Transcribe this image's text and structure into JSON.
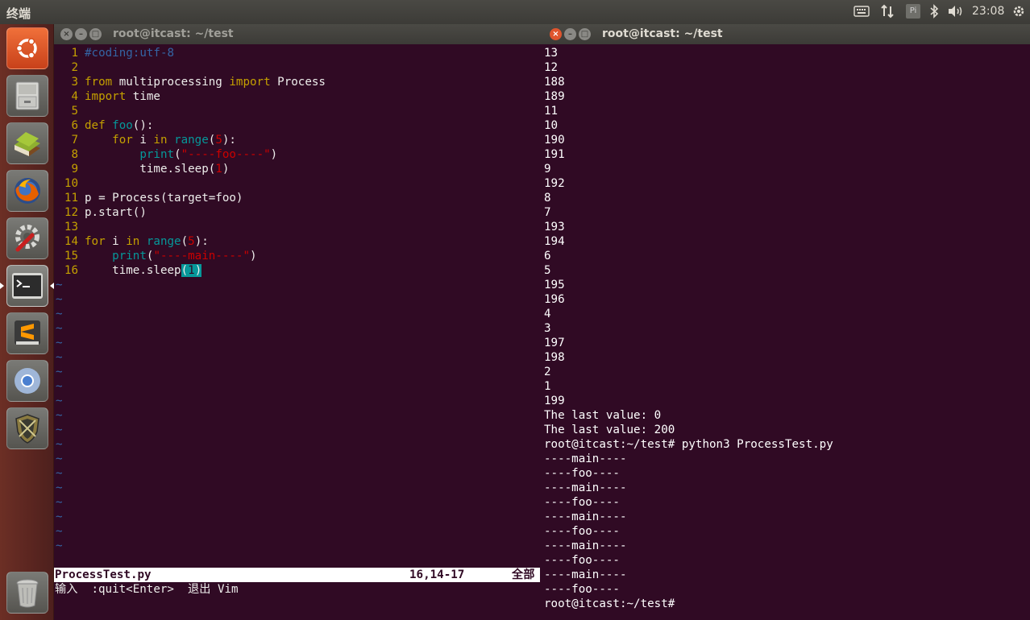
{
  "top_panel": {
    "title": "终端",
    "tray": {
      "keyboard_icon": "keyboard-icon",
      "network_icon": "network-updown-icon",
      "pinyin_label": "Pi",
      "bluetooth_icon": "bluetooth-icon",
      "volume_icon": "volume-icon",
      "clock": "23:08",
      "power_icon": "gear-icon"
    }
  },
  "launcher": {
    "items": [
      {
        "name": "ubuntu-dash",
        "icon": "ubuntu-logo-icon",
        "color": "#e95420"
      },
      {
        "name": "files",
        "icon": "file-cabinet-icon",
        "color": "#bcbcb6"
      },
      {
        "name": "reader",
        "icon": "books-icon",
        "color": "#7a9a2a"
      },
      {
        "name": "firefox",
        "icon": "firefox-icon",
        "color": "#e66000"
      },
      {
        "name": "system-settings",
        "icon": "settings-wrench-icon",
        "color": "#d0d0d0"
      },
      {
        "name": "terminal",
        "icon": "terminal-icon",
        "color": "#2e2e2e"
      },
      {
        "name": "sublime-text",
        "icon": "sublime-icon",
        "color": "#ff9800"
      },
      {
        "name": "chromium",
        "icon": "chromium-icon",
        "color": "#4a90e2"
      },
      {
        "name": "security-app",
        "icon": "shield-icon",
        "color": "#8a7a40"
      },
      {
        "name": "trash",
        "icon": "trash-icon",
        "color": "#b0b0b0"
      }
    ]
  },
  "vim_window": {
    "title": "root@itcast: ~/test",
    "lines": [
      {
        "n": "1",
        "tokens": [
          {
            "t": "#coding:utf-8",
            "c": "c-comment"
          }
        ]
      },
      {
        "n": "2",
        "tokens": []
      },
      {
        "n": "3",
        "tokens": [
          {
            "t": "from",
            "c": "c-kw"
          },
          {
            "t": " multiprocessing ",
            "c": "c-plain"
          },
          {
            "t": "import",
            "c": "c-kw"
          },
          {
            "t": " Process",
            "c": "c-plain"
          }
        ]
      },
      {
        "n": "4",
        "tokens": [
          {
            "t": "import",
            "c": "c-kw"
          },
          {
            "t": " time",
            "c": "c-plain"
          }
        ]
      },
      {
        "n": "5",
        "tokens": []
      },
      {
        "n": "6",
        "tokens": [
          {
            "t": "def",
            "c": "c-kw"
          },
          {
            "t": " ",
            "c": "c-plain"
          },
          {
            "t": "foo",
            "c": "c-fn"
          },
          {
            "t": "():",
            "c": "c-plain"
          }
        ]
      },
      {
        "n": "7",
        "tokens": [
          {
            "t": "    ",
            "c": "c-plain"
          },
          {
            "t": "for",
            "c": "c-kw"
          },
          {
            "t": " i ",
            "c": "c-plain"
          },
          {
            "t": "in",
            "c": "c-kw"
          },
          {
            "t": " ",
            "c": "c-plain"
          },
          {
            "t": "range",
            "c": "c-builtin"
          },
          {
            "t": "(",
            "c": "c-plain"
          },
          {
            "t": "5",
            "c": "c-num"
          },
          {
            "t": "):",
            "c": "c-plain"
          }
        ]
      },
      {
        "n": "8",
        "tokens": [
          {
            "t": "        ",
            "c": "c-plain"
          },
          {
            "t": "print",
            "c": "c-builtin"
          },
          {
            "t": "(",
            "c": "c-plain"
          },
          {
            "t": "\"----foo----\"",
            "c": "c-str"
          },
          {
            "t": ")",
            "c": "c-plain"
          }
        ]
      },
      {
        "n": "9",
        "tokens": [
          {
            "t": "        time.sleep(",
            "c": "c-plain"
          },
          {
            "t": "1",
            "c": "c-num"
          },
          {
            "t": ")",
            "c": "c-plain"
          }
        ]
      },
      {
        "n": "10",
        "tokens": []
      },
      {
        "n": "11",
        "tokens": [
          {
            "t": "p = Process(target=foo)",
            "c": "c-plain"
          }
        ]
      },
      {
        "n": "12",
        "tokens": [
          {
            "t": "p.start()",
            "c": "c-plain"
          }
        ]
      },
      {
        "n": "13",
        "tokens": []
      },
      {
        "n": "14",
        "tokens": [
          {
            "t": "for",
            "c": "c-kw"
          },
          {
            "t": " i ",
            "c": "c-plain"
          },
          {
            "t": "in",
            "c": "c-kw"
          },
          {
            "t": " ",
            "c": "c-plain"
          },
          {
            "t": "range",
            "c": "c-builtin"
          },
          {
            "t": "(",
            "c": "c-plain"
          },
          {
            "t": "5",
            "c": "c-num"
          },
          {
            "t": "):",
            "c": "c-plain"
          }
        ]
      },
      {
        "n": "15",
        "tokens": [
          {
            "t": "    ",
            "c": "c-plain"
          },
          {
            "t": "print",
            "c": "c-builtin"
          },
          {
            "t": "(",
            "c": "c-plain"
          },
          {
            "t": "\"----main----\"",
            "c": "c-str"
          },
          {
            "t": ")",
            "c": "c-plain"
          }
        ]
      },
      {
        "n": "16",
        "tokens": [
          {
            "t": "    time.sleep",
            "c": "c-plain"
          },
          {
            "t": "(",
            "c": "match"
          },
          {
            "t": "1",
            "c": "cursor"
          },
          {
            "t": ")",
            "c": "match"
          }
        ]
      }
    ],
    "tilde_count": 19,
    "tilde_char": "~",
    "status": {
      "filename": "ProcessTest.py",
      "position": "16,14-17",
      "scroll": "全部"
    },
    "message": "输入  :quit<Enter>  退出 Vim"
  },
  "terminal_window": {
    "title": "root@itcast: ~/test",
    "lines": [
      "13",
      "12",
      "188",
      "189",
      "11",
      "10",
      "190",
      "191",
      "9",
      "192",
      "8",
      "7",
      "193",
      "194",
      "6",
      "5",
      "195",
      "196",
      "4",
      "3",
      "197",
      "198",
      "2",
      "1",
      "199",
      "The last value: 0",
      "The last value: 200",
      "root@itcast:~/test# python3 ProcessTest.py",
      "----main----",
      "----foo----",
      "----main----",
      "----foo----",
      "----main----",
      "----foo----",
      "----main----",
      "----foo----",
      "----main----",
      "----foo----",
      "root@itcast:~/test# "
    ]
  },
  "colors": {
    "terminal_bg": "#300a24",
    "close_button": "#e0552d",
    "panel_bg": "#3c3b37"
  }
}
